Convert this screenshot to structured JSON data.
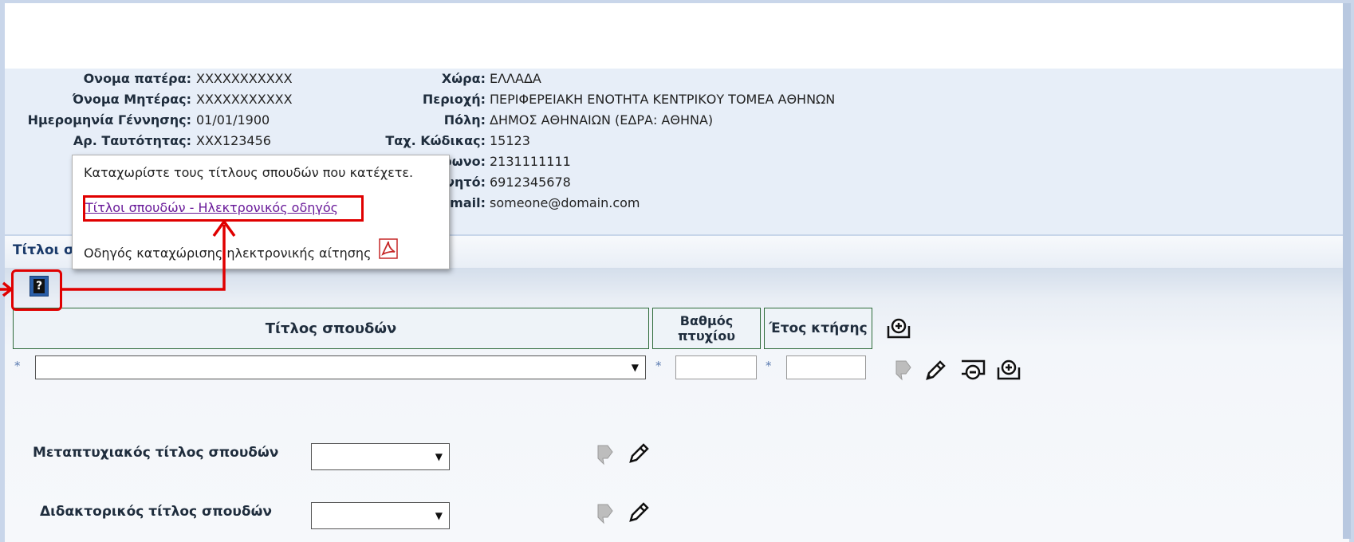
{
  "personal_info": {
    "left": [
      {
        "label": "Ονομα πατέρα:",
        "value": "XXXXXXXXXXX"
      },
      {
        "label": "Όνομα Μητέρας:",
        "value": "XXXXXXXXXXX"
      },
      {
        "label": "Ημερομηνία Γέννησης:",
        "value": "01/01/1900"
      },
      {
        "label": "Αρ. Ταυτότητας:",
        "value": "XXX123456"
      }
    ],
    "right": [
      {
        "label": "Χώρα:",
        "value": "ΕΛΛΑΔΑ"
      },
      {
        "label": "Περιοχή:",
        "value": "ΠΕΡΙΦΕΡΕΙΑΚΗ ΕΝΟΤΗΤΑ ΚΕΝΤΡΙΚΟΥ ΤΟΜΕΑ ΑΘΗΝΩΝ"
      },
      {
        "label": "Πόλη:",
        "value": "ΔΗΜΟΣ ΑΘΗΝΑΙΩΝ (ΕΔΡΑ: ΑΘΗΝΑ)"
      },
      {
        "label": "Ταχ. Κώδικας:",
        "value": "15123"
      },
      {
        "label": "Τηλέφωνο:",
        "value": "2131111111"
      },
      {
        "label": "Κινητό:",
        "value": "6912345678"
      },
      {
        "label": "E-mail:",
        "value": "someone@domain.com"
      }
    ]
  },
  "tab": {
    "title": "Τίτλοι σπουδών"
  },
  "popup": {
    "text": "Καταχωρίστε τους τίτλους σπουδών που κατέχετε.",
    "link": "Τίτλοι σπουδών - Ηλεκτρονικός οδηγός",
    "guide": "Οδηγός καταχώρισης ηλεκτρονικής αίτησης"
  },
  "table": {
    "col_title": "Τίτλος σπουδών",
    "col_grade": "Βαθμός πτυχίου",
    "col_year": "Έτος κτήσης",
    "required_mark": "*"
  },
  "postgrad": {
    "label": "Μεταπτυχιακός τίτλος σπουδών"
  },
  "doctoral": {
    "label": "Διδακτορικός τίτλος σπουδών"
  },
  "icons": {
    "help": "help-icon",
    "add": "add-row-icon",
    "move": "move-icon",
    "edit": "pencil-icon",
    "remove": "remove-row-icon",
    "pdf": "pdf-icon"
  },
  "colors": {
    "highlight": "#e00000",
    "panel": "#e7eef8",
    "header_border": "#2e6b3a"
  }
}
